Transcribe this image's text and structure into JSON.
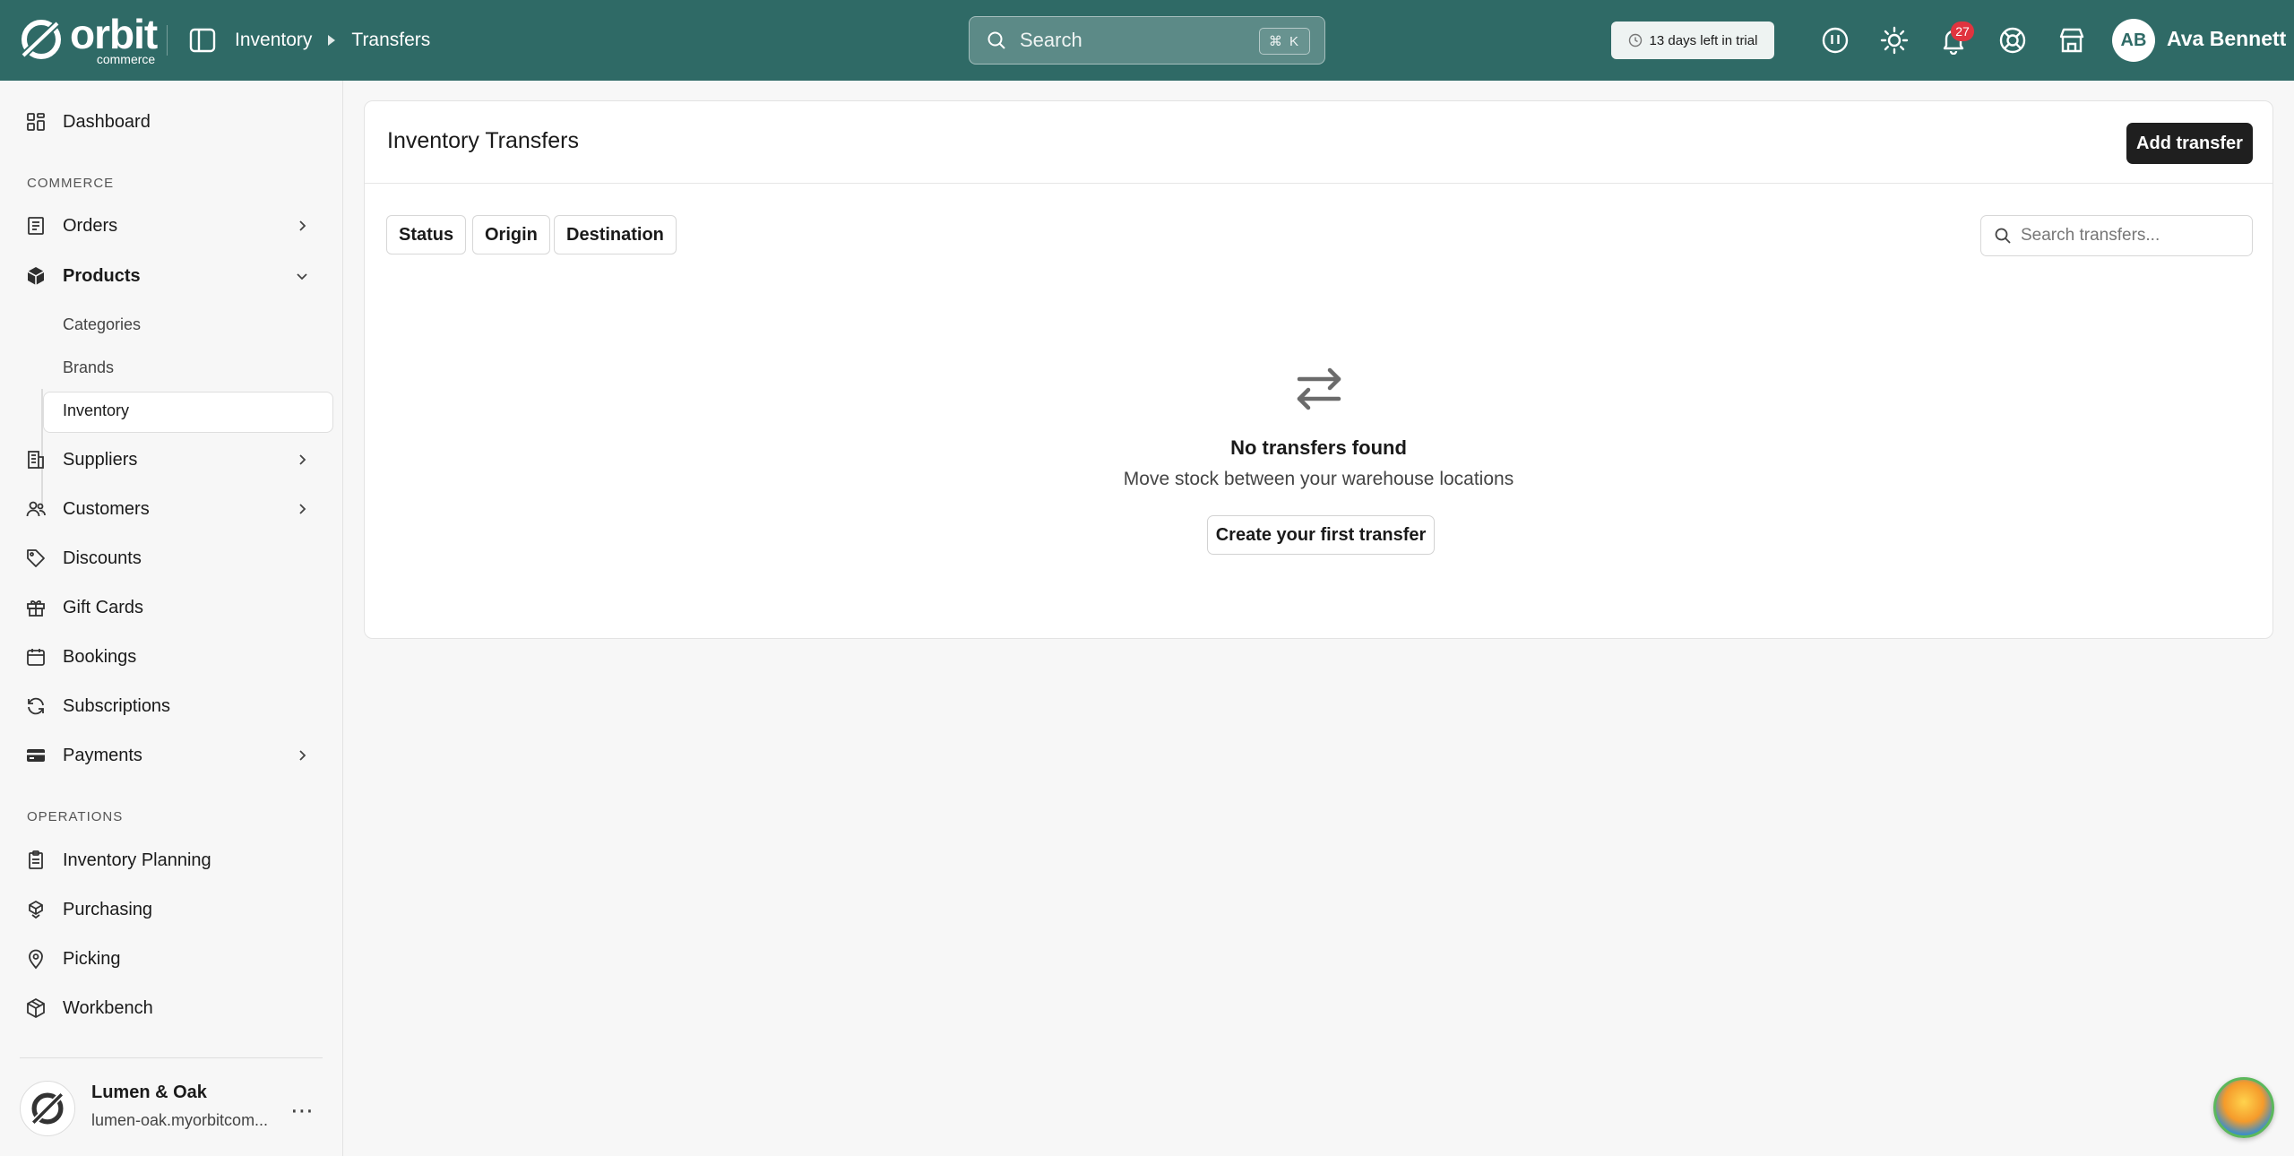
{
  "brand": {
    "word": "orbit",
    "sub": "commerce"
  },
  "breadcrumb": [
    "Inventory",
    "Transfers"
  ],
  "search": {
    "placeholder": "Search",
    "shortcut": "⌘ K"
  },
  "trial": "13 days left in trial",
  "notifications": {
    "count": "27"
  },
  "user": {
    "initials": "AB",
    "name": "Ava Bennett"
  },
  "sidebar": {
    "dashboard": "Dashboard",
    "commerce_label": "COMMERCE",
    "commerce": [
      "Orders",
      "Products",
      "Suppliers",
      "Customers",
      "Discounts",
      "Gift Cards",
      "Bookings",
      "Subscriptions",
      "Payments"
    ],
    "products_sub": [
      "Categories",
      "Brands",
      "Inventory"
    ],
    "operations_label": "OPERATIONS",
    "operations": [
      "Inventory Planning",
      "Purchasing",
      "Picking",
      "Workbench"
    ],
    "store": {
      "name": "Lumen & Oak",
      "url": "lumen-oak.myorbitcom..."
    }
  },
  "main": {
    "title": "Inventory Transfers",
    "add_button": "Add transfer",
    "filters": [
      "Status",
      "Origin",
      "Destination"
    ],
    "search_placeholder": "Search transfers...",
    "empty": {
      "title": "No transfers found",
      "subtitle": "Move stock between your warehouse locations",
      "button": "Create your first transfer"
    }
  },
  "colors": {
    "topbar": "#2f6a66",
    "badge": "#e0343f",
    "primary_button": "#1f1f1f"
  }
}
